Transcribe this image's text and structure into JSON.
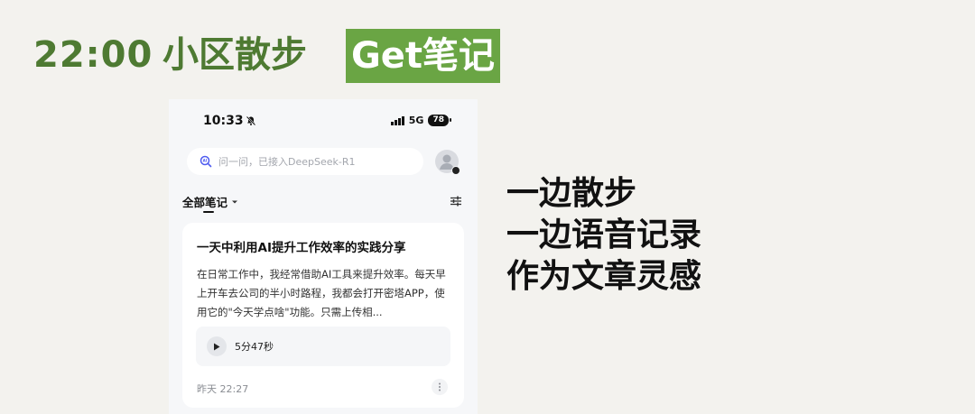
{
  "header": {
    "time": "22:00",
    "scene": "小区散步",
    "badge": "Get笔记"
  },
  "colors": {
    "accent_green": "#4e7a32",
    "badge_green": "#6aa544",
    "background": "#f3f2ee"
  },
  "phone": {
    "status_bar": {
      "time": "10:33",
      "network": "5G",
      "battery": "78",
      "icons": [
        "mute-bell-icon",
        "signal-icon"
      ]
    },
    "search": {
      "placeholder": "问一问，已接入DeepSeek-R1",
      "icon": "ai-search-icon"
    },
    "filter": {
      "label": "全部笔记",
      "dropdown_icon": "caret-down-icon",
      "settings_icon": "sliders-icon"
    },
    "note": {
      "title": "一天中利用AI提升工作效率的实践分享",
      "body": "在日常工作中，我经常借助AI工具来提升效率。每天早上开车去公司的半小时路程，我都会打开密塔APP，使用它的\"今天学点啥\"功能。只需上传相...",
      "audio_duration": "5分47秒",
      "timestamp": "昨天 22:27"
    }
  },
  "side_text": {
    "line1": "一边散步",
    "line2": "一边语音记录",
    "line3": "作为文章灵感"
  }
}
